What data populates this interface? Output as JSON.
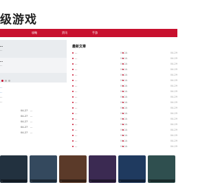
{
  "header": {
    "logo_text": "级游戏"
  },
  "nav": {
    "items": [
      "",
      "",
      "攻略",
      "",
      "资讯",
      "",
      "手游",
      "",
      "",
      "",
      ""
    ]
  },
  "featured": {
    "title": "…",
    "desc": "…"
  },
  "card2": {
    "title": "…",
    "desc": "…"
  },
  "section": {
    "title": "最新文章"
  },
  "left_headlines": [
    "…",
    "…",
    "…",
    "…"
  ],
  "left_mini_rows": [
    {
      "date": "04-27",
      "text": "…"
    },
    {
      "date": "04-27",
      "text": "…"
    },
    {
      "date": "04-27",
      "text": "…"
    },
    {
      "date": "04-27",
      "text": "…"
    },
    {
      "date": "04-27",
      "text": "…"
    }
  ],
  "news_col1": [
    {
      "title": "…",
      "date": "04-29"
    },
    {
      "title": "…",
      "date": "04-29"
    },
    {
      "title": "…",
      "date": "04-29"
    },
    {
      "title": "…",
      "date": "04-29"
    },
    {
      "title": "…",
      "date": "04-29"
    },
    {
      "title": "…",
      "date": "04-29"
    },
    {
      "title": "…",
      "date": "04-29"
    },
    {
      "title": "…",
      "date": "04-29"
    },
    {
      "title": "…",
      "date": "04-29"
    },
    {
      "title": "…",
      "date": "04-29"
    },
    {
      "title": "…",
      "date": "04-29"
    },
    {
      "title": "…",
      "date": "04-29"
    },
    {
      "title": "…",
      "date": "04-29"
    },
    {
      "title": "…",
      "date": "04-29"
    },
    {
      "title": "…",
      "date": "04-29"
    },
    {
      "title": "…",
      "date": "04-29"
    },
    {
      "title": "…",
      "date": "04-29"
    },
    {
      "title": "…",
      "date": "04-29"
    }
  ],
  "news_col2": [
    {
      "title": "…",
      "date": "04-29"
    },
    {
      "title": "…",
      "date": "04-29"
    },
    {
      "title": "…",
      "date": "04-29"
    },
    {
      "title": "…",
      "date": "04-29"
    },
    {
      "title": "…",
      "date": "04-29"
    },
    {
      "title": "…",
      "date": "04-29"
    },
    {
      "title": "…",
      "date": "04-29"
    },
    {
      "title": "…",
      "date": "04-29"
    },
    {
      "title": "…",
      "date": "04-29"
    },
    {
      "title": "…",
      "date": "04-29"
    },
    {
      "title": "…",
      "date": "04-29"
    },
    {
      "title": "…",
      "date": "04-29"
    },
    {
      "title": "…",
      "date": "04-29"
    },
    {
      "title": "…",
      "date": "04-29"
    },
    {
      "title": "…",
      "date": "04-29"
    },
    {
      "title": "…",
      "date": "04-29"
    },
    {
      "title": "…",
      "date": "04-29"
    },
    {
      "title": "…",
      "date": "04-29"
    }
  ],
  "thumbs": [
    {
      "caption": "…"
    },
    {
      "caption": "…"
    },
    {
      "caption": "…"
    },
    {
      "caption": "…"
    },
    {
      "caption": "…"
    },
    {
      "caption": "…"
    }
  ],
  "colors": {
    "accent": "#c8102e",
    "link": "#1a5dab"
  }
}
